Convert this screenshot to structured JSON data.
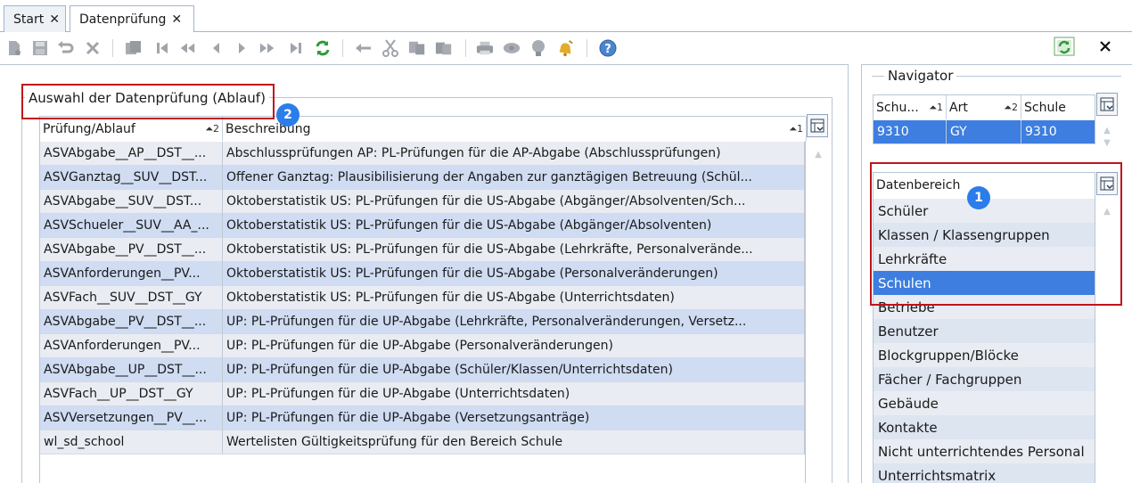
{
  "tabs": [
    {
      "label": "Start",
      "close": "✕"
    },
    {
      "label": "Datenprüfung",
      "close": "✕"
    }
  ],
  "toolbar_icons": [
    "new-icon",
    "save-icon",
    "undo-icon",
    "delete-icon",
    "copy-record-icon",
    "first-icon",
    "prev-page-icon",
    "prev-icon",
    "next-icon",
    "next-page-icon",
    "last-icon",
    "refresh-icon",
    "back-arrow-icon",
    "cut-icon",
    "copy-icon",
    "paste-icon",
    "print-icon",
    "preview-icon",
    "idea-icon",
    "bell-icon",
    "help-icon",
    "export-excel-icon",
    "close-icon"
  ],
  "left": {
    "fieldset_title": "Auswahl der Datenprüfung (Ablauf)",
    "columns": [
      {
        "label": "Prüfung/Ablauf",
        "sort": "⏶2"
      },
      {
        "label": "Beschreibung",
        "sort": "⏶1"
      }
    ],
    "rows": [
      [
        "ASVAbgabe__AP__DST__...",
        "Abschlussprüfungen AP: PL-Prüfungen für die AP-Abgabe (Abschlussprüfungen)"
      ],
      [
        "ASVGanztag__SUV__DST...",
        "Offener Ganztag: Plausibilisierung der Angaben zur ganztägigen Betreuung (Schül..."
      ],
      [
        "ASVAbgabe__SUV__DST...",
        "Oktoberstatistik US: PL-Prüfungen für die US-Abgabe (Abgänger/Absolventen/Sch..."
      ],
      [
        "ASVSchueler__SUV__AA_...",
        "Oktoberstatistik US: PL-Prüfungen für die US-Abgabe (Abgänger/Absolventen)"
      ],
      [
        "ASVAbgabe__PV__DST__...",
        "Oktoberstatistik US: PL-Prüfungen für die US-Abgabe (Lehrkräfte, Personalverände..."
      ],
      [
        "ASVAnforderungen__PV...",
        "Oktoberstatistik US: PL-Prüfungen für die US-Abgabe (Personalveränderungen)"
      ],
      [
        "ASVFach__SUV__DST__GY",
        "Oktoberstatistik US: PL-Prüfungen für die US-Abgabe (Unterrichtsdaten)"
      ],
      [
        "ASVAbgabe__PV__DST__...",
        "UP: PL-Prüfungen für die UP-Abgabe (Lehrkräfte, Personalveränderungen, Versetz..."
      ],
      [
        "ASVAnforderungen__PV...",
        "UP: PL-Prüfungen für die UP-Abgabe (Personalveränderungen)"
      ],
      [
        "ASVAbgabe__UP__DST__...",
        "UP: PL-Prüfungen für die UP-Abgabe (Schüler/Klassen/Unterrichtsdaten)"
      ],
      [
        "ASVFach__UP__DST__GY",
        "UP: PL-Prüfungen für die UP-Abgabe (Unterrichtsdaten)"
      ],
      [
        "ASVVersetzungen__PV__...",
        "UP: PL-Prüfungen für die UP-Abgabe (Versetzungsanträge)"
      ],
      [
        "wl_sd_school",
        "Wertelisten Gültigkeitsprüfung für den Bereich Schule"
      ]
    ],
    "badge": "2"
  },
  "navigator": {
    "title": "Navigator",
    "columns": [
      {
        "label": "Schu...",
        "sort": "⏶1"
      },
      {
        "label": "Art",
        "sort": "⏶2"
      },
      {
        "label": "Schule",
        "sort": ""
      }
    ],
    "row": [
      "9310",
      "GY",
      "9310"
    ]
  },
  "datenbereich": {
    "title": "Datenbereich",
    "items": [
      "Schüler",
      "Klassen / Klassengruppen",
      "Lehrkräfte",
      "Schulen",
      "Betriebe",
      "Benutzer",
      "Blockgruppen/Blöcke",
      "Fächer / Fachgruppen",
      "Gebäude",
      "Kontakte",
      "Nicht unterrichtendes Personal",
      "Unterrichtsmatrix"
    ],
    "selected_index": 3,
    "badge": "1"
  },
  "colors": {
    "selected": "#3d7ee0",
    "row_odd": "#e9edf3",
    "row_even": "#cfdcf2",
    "highlight": "#c0141c",
    "badge": "#2b7de9"
  }
}
